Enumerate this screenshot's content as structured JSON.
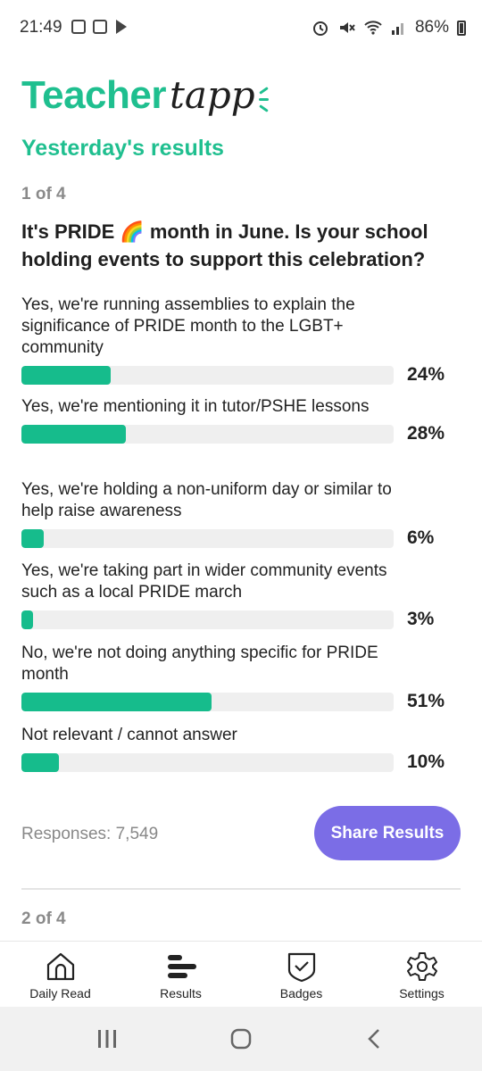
{
  "status_bar": {
    "time": "21:49",
    "battery": "86%"
  },
  "logo": {
    "teacher": "Teacher",
    "tapp": "tapp"
  },
  "section_title": "Yesterday's results",
  "poll": {
    "counter": "1 of 4",
    "question": "It's PRIDE 🌈 month in June. Is your school holding events to support this celebration?",
    "options": [
      {
        "label": "Yes, we're running assemblies to explain the significance of PRIDE month to the LGBT+ community",
        "percent_text": "24%",
        "value": 24
      },
      {
        "label": "Yes, we're mentioning it in tutor/PSHE lessons",
        "percent_text": "28%",
        "value": 28
      },
      {
        "label": "Yes, we're holding a non-uniform day or similar to help raise awareness",
        "percent_text": "6%",
        "value": 6
      },
      {
        "label": "Yes, we're taking part in wider community events such as a local PRIDE march",
        "percent_text": "3%",
        "value": 3
      },
      {
        "label": "No, we're not doing anything specific for PRIDE month",
        "percent_text": "51%",
        "value": 51
      },
      {
        "label": "Not relevant / cannot answer",
        "percent_text": "10%",
        "value": 10
      }
    ],
    "responses": "Responses: 7,549",
    "share_label": "Share Results"
  },
  "next_counter": "2 of 4",
  "nav": [
    {
      "label": "Daily Read",
      "icon": "home-icon"
    },
    {
      "label": "Results",
      "icon": "results-icon"
    },
    {
      "label": "Badges",
      "icon": "badge-icon"
    },
    {
      "label": "Settings",
      "icon": "gear-icon"
    }
  ],
  "colors": {
    "brand_green": "#1fbf8f",
    "bar_fill": "#16bc8c",
    "bar_track": "#efefef",
    "share_button": "#7b6de6"
  }
}
